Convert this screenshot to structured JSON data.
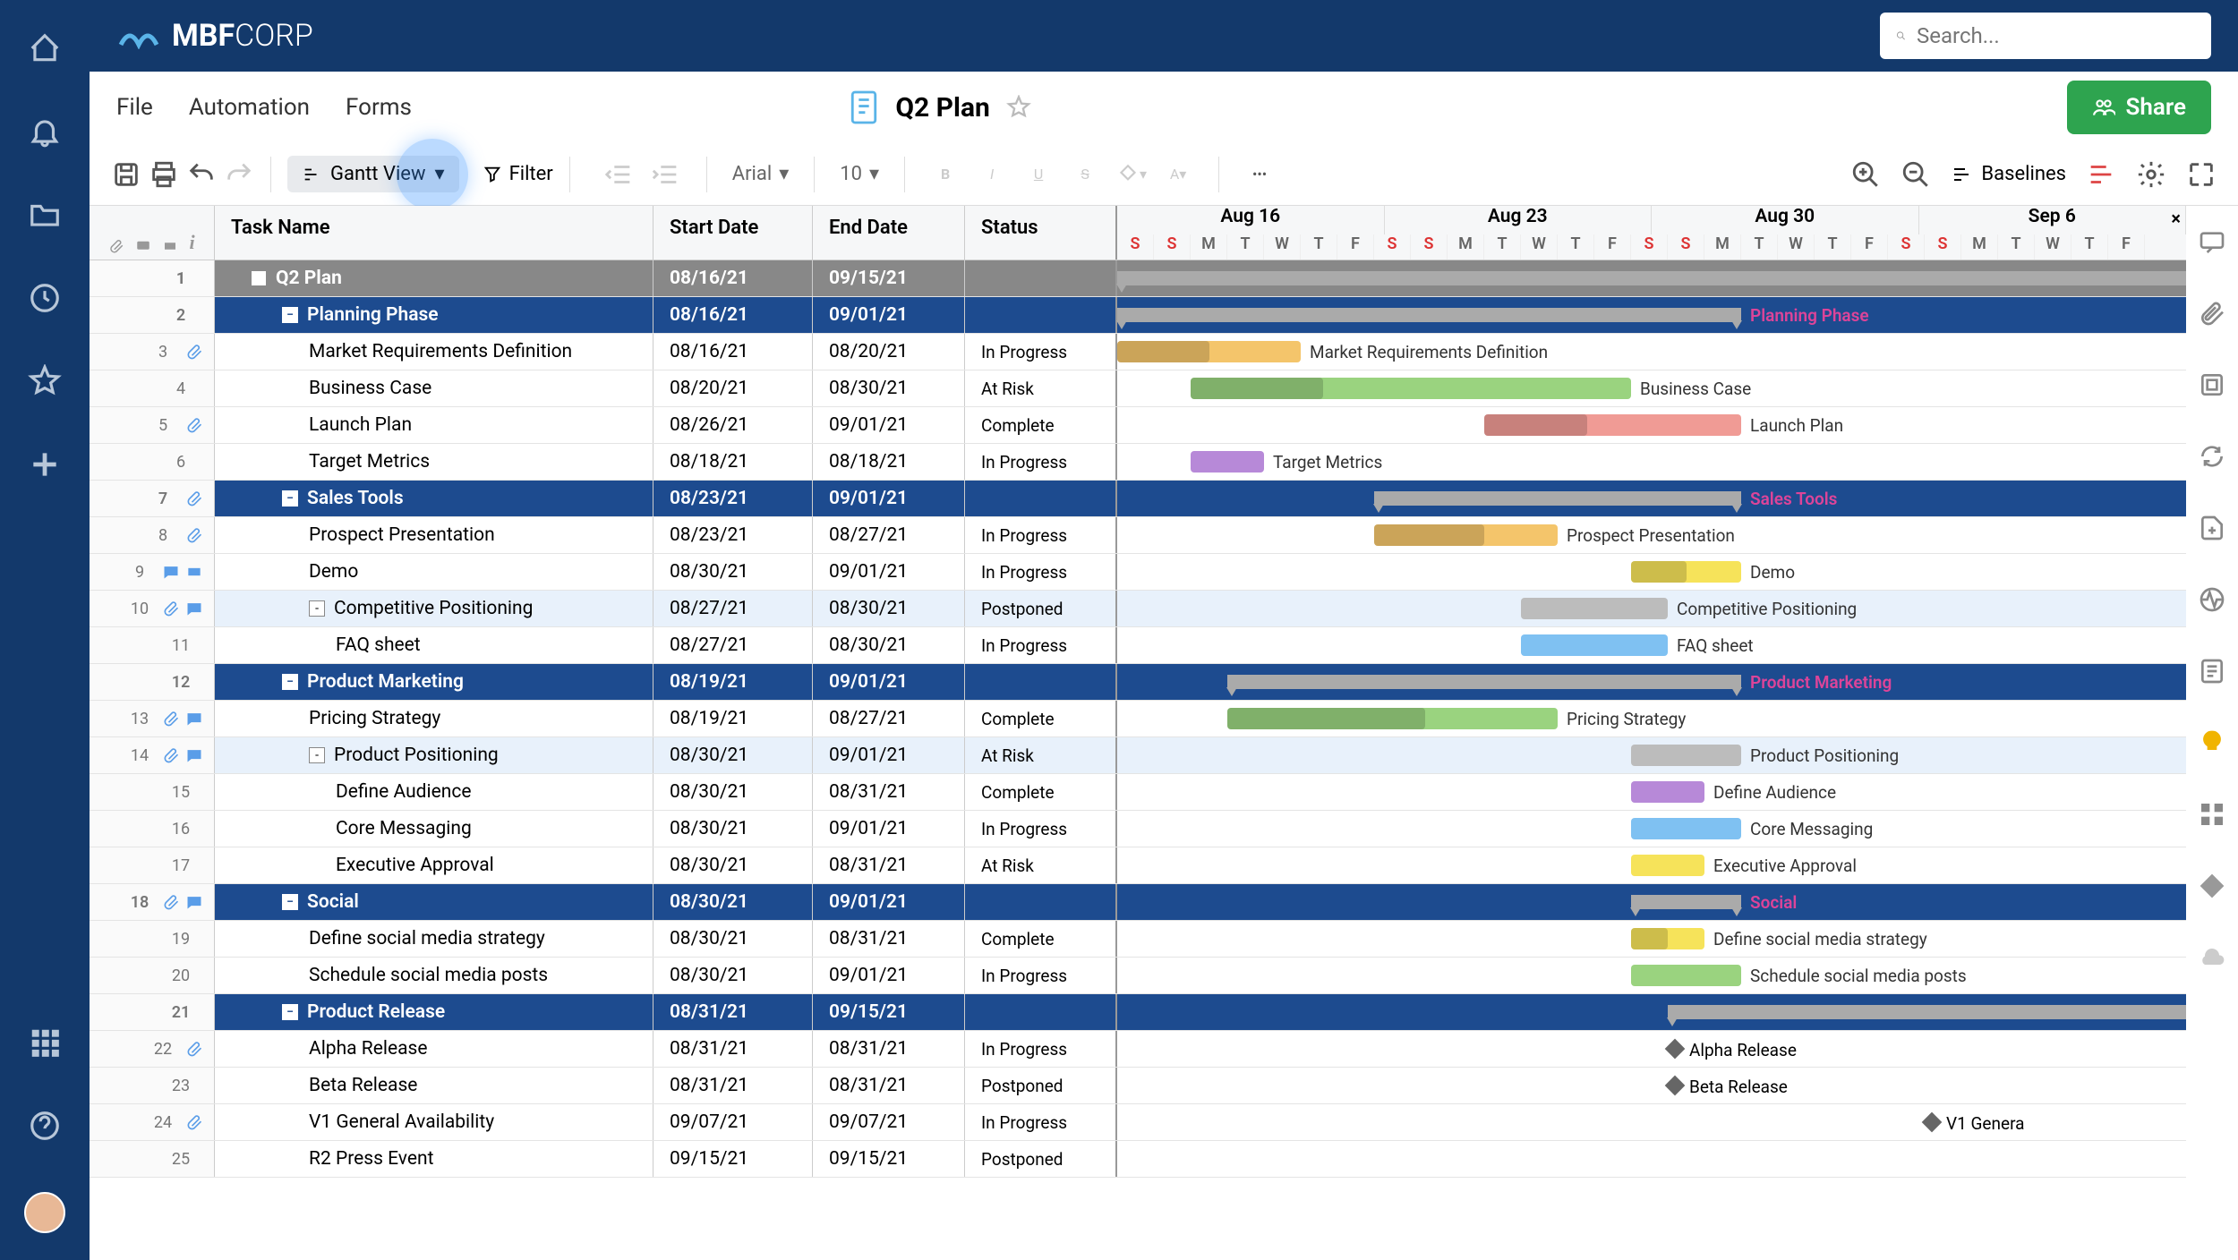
{
  "brand": {
    "name_bold": "MBF",
    "name_light": "CORP"
  },
  "search": {
    "placeholder": "Search..."
  },
  "menu": {
    "file": "File",
    "automation": "Automation",
    "forms": "Forms"
  },
  "page": {
    "title": "Q2 Plan"
  },
  "share": {
    "label": "Share"
  },
  "toolbar": {
    "view": "Gantt View",
    "filter": "Filter",
    "font": "Arial",
    "size": "10",
    "baselines": "Baselines"
  },
  "columns": {
    "task": "Task Name",
    "start": "Start Date",
    "end": "End Date",
    "status": "Status"
  },
  "weeks": [
    "Aug 16",
    "Aug 23",
    "Aug 30",
    "Sep 6"
  ],
  "days": [
    "S",
    "S",
    "M",
    "T",
    "W",
    "T",
    "F",
    "S",
    "S",
    "M",
    "T",
    "W",
    "T",
    "F",
    "S",
    "S",
    "M",
    "T",
    "W",
    "T",
    "F",
    "S",
    "S",
    "M",
    "T",
    "W",
    "T",
    "F"
  ],
  "weekend_idx": [
    0,
    1,
    7,
    8,
    14,
    15,
    21,
    22
  ],
  "day_width": 41,
  "gantt_origin_day": 1,
  "rows": [
    {
      "n": 1,
      "lvl": 0,
      "name": "Q2 Plan",
      "start": "08/16/21",
      "end": "09/15/21",
      "status": "",
      "bar": {
        "type": "summary",
        "s": 1,
        "e": 30
      }
    },
    {
      "n": 2,
      "lvl": 1,
      "name": "Planning Phase",
      "start": "08/16/21",
      "end": "09/01/21",
      "status": "",
      "bar": {
        "type": "summary",
        "s": 1,
        "e": 17,
        "label": "Planning Phase",
        "labelColor": "#d49"
      }
    },
    {
      "n": 3,
      "lvl": 2,
      "name": "Market Requirements Definition",
      "start": "08/16/21",
      "end": "08/20/21",
      "status": "In Progress",
      "paperclip": true,
      "bar": {
        "type": "task",
        "s": 1,
        "e": 5,
        "color": "#f4c56b",
        "prog": 50,
        "label": "Market Requirements Definition"
      }
    },
    {
      "n": 4,
      "lvl": 2,
      "name": "Business Case",
      "start": "08/20/21",
      "end": "08/30/21",
      "status": "At Risk",
      "bar": {
        "type": "task",
        "s": 3,
        "e": 14,
        "color": "#9ad37f",
        "prog": 30,
        "label": "Business Case"
      }
    },
    {
      "n": 5,
      "lvl": 2,
      "name": "Launch Plan",
      "start": "08/26/21",
      "end": "09/01/21",
      "status": "Complete",
      "paperclip": true,
      "bar": {
        "type": "task",
        "s": 11,
        "e": 17,
        "color": "#f09b95",
        "prog": 40,
        "label": "Launch Plan"
      }
    },
    {
      "n": 6,
      "lvl": 2,
      "name": "Target Metrics",
      "start": "08/18/21",
      "end": "08/18/21",
      "status": "In Progress",
      "bar": {
        "type": "task",
        "s": 3,
        "e": 4,
        "color": "#b789d8",
        "label": "Target Metrics"
      }
    },
    {
      "n": 7,
      "lvl": 1,
      "name": "Sales Tools",
      "start": "08/23/21",
      "end": "09/01/21",
      "status": "",
      "paperclip": true,
      "bar": {
        "type": "summary",
        "s": 8,
        "e": 17,
        "label": "Sales Tools",
        "labelColor": "#d49"
      }
    },
    {
      "n": 8,
      "lvl": 2,
      "name": "Prospect Presentation",
      "start": "08/23/21",
      "end": "08/27/21",
      "status": "In Progress",
      "paperclip": true,
      "bar": {
        "type": "task",
        "s": 8,
        "e": 12,
        "color": "#f4c56b",
        "prog": 60,
        "label": "Prospect Presentation"
      }
    },
    {
      "n": 9,
      "lvl": 2,
      "name": "Demo",
      "start": "08/30/21",
      "end": "09/01/21",
      "status": "In Progress",
      "comment": true,
      "extra_ico": true,
      "bar": {
        "type": "task",
        "s": 15,
        "e": 17,
        "color": "#f6e35a",
        "prog": 50,
        "label": "Demo"
      }
    },
    {
      "n": 10,
      "lvl": 2,
      "hl": true,
      "toggle": "-",
      "name": "Competitive Positioning",
      "start": "08/27/21",
      "end": "08/30/21",
      "status": "Postponed",
      "paperclip": true,
      "comment": true,
      "bar": {
        "type": "task",
        "s": 12,
        "e": 15,
        "color": "#bcbcbc",
        "label": "Competitive Positioning"
      }
    },
    {
      "n": 11,
      "lvl": 3,
      "name": "FAQ sheet",
      "start": "08/27/21",
      "end": "08/30/21",
      "status": "In Progress",
      "bar": {
        "type": "task",
        "s": 12,
        "e": 15,
        "color": "#7fc1f2",
        "label": "FAQ sheet"
      }
    },
    {
      "n": 12,
      "lvl": 1,
      "name": "Product Marketing",
      "start": "08/19/21",
      "end": "09/01/21",
      "status": "",
      "bar": {
        "type": "summary",
        "s": 4,
        "e": 17,
        "label": "Product Marketing",
        "labelColor": "#d49"
      }
    },
    {
      "n": 13,
      "lvl": 2,
      "name": "Pricing Strategy",
      "start": "08/19/21",
      "end": "08/27/21",
      "status": "Complete",
      "paperclip": true,
      "comment": true,
      "bar": {
        "type": "task",
        "s": 4,
        "e": 12,
        "color": "#9ad37f",
        "prog": 60,
        "label": "Pricing Strategy"
      }
    },
    {
      "n": 14,
      "lvl": 2,
      "hl": true,
      "toggle": "-",
      "name": "Product Positioning",
      "start": "08/30/21",
      "end": "09/01/21",
      "status": "At Risk",
      "paperclip": true,
      "comment": true,
      "bar": {
        "type": "task",
        "s": 15,
        "e": 17,
        "color": "#bcbcbc",
        "label": "Product Positioning"
      }
    },
    {
      "n": 15,
      "lvl": 3,
      "name": "Define Audience",
      "start": "08/30/21",
      "end": "08/31/21",
      "status": "Complete",
      "bar": {
        "type": "task",
        "s": 15,
        "e": 16,
        "color": "#b789d8",
        "label": "Define Audience"
      }
    },
    {
      "n": 16,
      "lvl": 3,
      "name": "Core Messaging",
      "start": "08/30/21",
      "end": "09/01/21",
      "status": "In Progress",
      "bar": {
        "type": "task",
        "s": 15,
        "e": 17,
        "color": "#7fc1f2",
        "label": "Core Messaging"
      }
    },
    {
      "n": 17,
      "lvl": 3,
      "name": "Executive Approval",
      "start": "08/30/21",
      "end": "08/31/21",
      "status": "At Risk",
      "bar": {
        "type": "task",
        "s": 15,
        "e": 16,
        "color": "#f6e35a",
        "label": "Executive Approval"
      }
    },
    {
      "n": 18,
      "lvl": 1,
      "name": "Social",
      "start": "08/30/21",
      "end": "09/01/21",
      "status": "",
      "paperclip": true,
      "comment": true,
      "bar": {
        "type": "summary",
        "s": 15,
        "e": 17,
        "label": "Social",
        "labelColor": "#d49"
      }
    },
    {
      "n": 19,
      "lvl": 2,
      "name": "Define social media strategy",
      "start": "08/30/21",
      "end": "08/31/21",
      "status": "Complete",
      "bar": {
        "type": "task",
        "s": 15,
        "e": 16,
        "color": "#f6e35a",
        "prog": 50,
        "label": "Define social media strategy"
      }
    },
    {
      "n": 20,
      "lvl": 2,
      "name": "Schedule social media posts",
      "start": "08/30/21",
      "end": "09/01/21",
      "status": "In Progress",
      "bar": {
        "type": "task",
        "s": 15,
        "e": 17,
        "color": "#9ad37f",
        "label": "Schedule social media posts"
      }
    },
    {
      "n": 21,
      "lvl": 1,
      "name": "Product Release",
      "start": "08/31/21",
      "end": "09/15/21",
      "status": "",
      "bar": {
        "type": "summary",
        "s": 16,
        "e": 30
      }
    },
    {
      "n": 22,
      "lvl": 2,
      "name": "Alpha Release",
      "start": "08/31/21",
      "end": "08/31/21",
      "status": "In Progress",
      "paperclip": true,
      "bar": {
        "type": "milestone",
        "s": 16,
        "label": "Alpha Release"
      }
    },
    {
      "n": 23,
      "lvl": 2,
      "name": "Beta Release",
      "start": "08/31/21",
      "end": "08/31/21",
      "status": "Postponed",
      "bar": {
        "type": "milestone",
        "s": 16,
        "label": "Beta Release"
      }
    },
    {
      "n": 24,
      "lvl": 2,
      "name": "V1 General Availability",
      "start": "09/07/21",
      "end": "09/07/21",
      "status": "In Progress",
      "paperclip": true,
      "bar": {
        "type": "milestone",
        "s": 23,
        "label": "V1 Genera"
      }
    },
    {
      "n": 25,
      "lvl": 2,
      "name": "R2 Press Event",
      "start": "09/15/21",
      "end": "09/15/21",
      "status": "Postponed"
    }
  ]
}
